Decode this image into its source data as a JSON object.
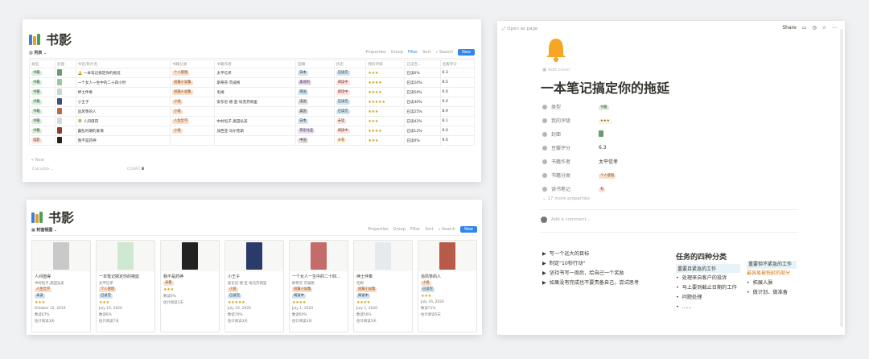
{
  "db_title": "书影",
  "table_view": {
    "view_label": "列表",
    "toolbar": [
      "Properties",
      "Group",
      "Filter",
      "Sort",
      "Search"
    ],
    "new_label": "New",
    "headers": [
      "类型",
      "封面",
      "书名/影片名",
      "书籍分类",
      "书籍作者",
      "国籍",
      "状态",
      "我的评级",
      "已读百...",
      "豆瓣评分"
    ],
    "rows": [
      {
        "type": "书籍",
        "cover": "#6a9b6e",
        "name": "一本笔记搞定你的拖延",
        "name_icon": "🔔",
        "cat": "个人管理",
        "cat_c": "t-orange",
        "author": "太平信孝",
        "nation": "日本",
        "nat_c": "t-blue",
        "status": "已读完",
        "st_c": "t-blue",
        "stars": "★★★",
        "pct": "已读6%",
        "score": "6.3"
      },
      {
        "type": "书籍",
        "cover": "#9bc4a4",
        "name": "一个女人一生中的二十四小时",
        "name_icon": "",
        "cat": "短篇小说集",
        "cat_c": "t-orange",
        "author": "斯蒂芬·茨威格",
        "nation": "奥地利",
        "nat_c": "t-purple",
        "status": "阅读中",
        "st_c": "t-red",
        "stars": "★★★★",
        "pct": "已读20%",
        "score": "8.5"
      },
      {
        "type": "书籍",
        "cover": "#c5d7cf",
        "name": "绅士伴奏",
        "name_icon": "",
        "cat": "短篇小说集",
        "cat_c": "t-orange",
        "author": "毛姆",
        "nation": "英国",
        "nat_c": "t-blue",
        "status": "阅读中",
        "st_c": "t-red",
        "stars": "★★★★",
        "pct": "已读50%",
        "score": "0.0"
      },
      {
        "type": "书籍",
        "cover": "#3a4f7a",
        "name": "小王子",
        "name_icon": "",
        "cat": "小说",
        "cat_c": "t-orange",
        "author": "安东尼·德·圣-埃克苏佩里",
        "nation": "法国",
        "nat_c": "t-gray",
        "status": "已读完",
        "st_c": "t-blue",
        "stars": "★★★★★",
        "pct": "已读30%",
        "score": "9.0"
      },
      {
        "type": "书籍",
        "cover": "#b56a4a",
        "name": "追风筝的人",
        "name_icon": "",
        "cat": "小说",
        "cat_c": "t-orange",
        "author": "",
        "nation": "美国",
        "nat_c": "t-gray",
        "status": "已读完",
        "st_c": "t-blue",
        "stars": "★★★",
        "pct": "已读25%",
        "score": "8.9"
      },
      {
        "type": "书籍",
        "cover": "#d8d8d8",
        "name": "人间值得",
        "name_icon": "🍀",
        "cat": "人生哲学",
        "cat_c": "t-orange",
        "author": "中村恒子,奥田弘美",
        "nation": "日本",
        "nat_c": "t-blue",
        "status": "未读",
        "st_c": "t-red",
        "stars": "★★★",
        "pct": "已读42%",
        "score": "8.1"
      },
      {
        "type": "书籍",
        "cover": "#8f3b2f",
        "name": "霸乱时期的爱情",
        "name_icon": "",
        "cat": "小说",
        "cat_c": "t-orange",
        "author": "加西亚·马尔克斯",
        "nation": "哥伦比亚",
        "nat_c": "t-purple",
        "status": "阅读中",
        "st_c": "t-red",
        "stars": "★★★★",
        "pct": "已读12%",
        "score": "9.0"
      },
      {
        "type": "电影",
        "cover": "#222",
        "name": "我不是药神",
        "name_icon": "",
        "cat": "",
        "cat_c": "",
        "author": "",
        "nation": "中国",
        "nat_c": "t-gray",
        "status": "未看",
        "st_c": "t-yellow",
        "stars": "★★★",
        "pct": "已读0%",
        "score": "9.0"
      }
    ],
    "new_row": "+ New",
    "calculate": "Calculate",
    "count_label": "COUNT",
    "count": "8"
  },
  "gallery_view": {
    "view_label": "封面视图",
    "cards": [
      {
        "img": "#c9c9c9",
        "name": "人间值得",
        "author": "中村恒子,奥田弘美",
        "tag": "人生哲学",
        "tag2": "未读",
        "stars": "★★★",
        "date": "October 12, 2019",
        "pct": "数读67%",
        "extra": "估计阅读3天"
      },
      {
        "img": "#cfe8d2",
        "name": "一本笔记搞定你的拖延",
        "author": "太平信孝",
        "tag": "个人管理",
        "tag2": "已读完",
        "stars": "★★★",
        "date": "July 16, 2020",
        "pct": "数读6%",
        "extra": "估计阅读7天"
      },
      {
        "img": "#222",
        "name": "我不是药神",
        "author": "",
        "tag": "未看",
        "tag2": "",
        "stars": "★★★",
        "date": "",
        "pct": "数读0%",
        "extra": "估计阅读1天"
      },
      {
        "img": "#2a3a6a",
        "name": "小王子",
        "author": "安东尼·德·圣-埃克苏佩里",
        "tag": "小说",
        "tag2": "已读完",
        "stars": "★★★★★",
        "date": "July 16, 2020",
        "pct": "数读70%",
        "extra": "估计阅读3天"
      },
      {
        "img": "#c46b6b",
        "name": "一个女人一生中的二十四...",
        "author": "斯蒂芬·茨威格",
        "tag": "短篇小说集",
        "tag2": "阅读中",
        "stars": "★★★★",
        "date": "July 1, 2020",
        "pct": "数读60%",
        "extra": "估计阅读3天"
      },
      {
        "img": "#e4eaee",
        "name": "绅士伴奏",
        "author": "毛姆",
        "tag": "短篇小说集",
        "tag2": "阅读中",
        "stars": "★★★★",
        "date": "July 1, 2020",
        "pct": "数读50%",
        "extra": "估计阅读5天"
      },
      {
        "img": "#b85a4a",
        "name": "追风筝的人",
        "author": "",
        "tag": "小说",
        "tag2": "已读完",
        "stars": "★★★",
        "date": "July 16, 2020",
        "pct": "数读71%",
        "extra": "估计阅读5天"
      }
    ]
  },
  "page_view": {
    "open_as_page": "Open as page",
    "share": "Share",
    "add_cover": "Add cover",
    "title": "一本笔记搞定你的拖延",
    "props": [
      {
        "k": "类型",
        "v": "书籍",
        "c": "t-green"
      },
      {
        "k": "我的评级",
        "v": "★★★",
        "c": "t-yellow"
      },
      {
        "k": "封面",
        "v": "",
        "c": ""
      },
      {
        "k": "豆瓣评分",
        "v": "6.3",
        "c": ""
      },
      {
        "k": "书籍作者",
        "v": "太平信孝",
        "c": ""
      },
      {
        "k": "书籍分类",
        "v": "个人管理",
        "c": "t-orange"
      },
      {
        "k": "读书笔记",
        "v": "有",
        "c": "t-red"
      }
    ],
    "more_props": "17 more properties",
    "add_comment": "Add a comment...",
    "bullets": [
      "写一个远大的目标",
      "制定\"10秒行动\"",
      "坚持书写一周后，给自己一个奖励",
      "如果没有完成也不要责备自己，尝试思考"
    ],
    "quad_title": "任务的四种分类",
    "quad1_title": "重要且紧急的工作",
    "quad1_items": [
      "处理来自客户的投诉",
      "马上要到截止日期的工作",
      "问题处理",
      "......"
    ],
    "quad2_title": "重要但不紧急的工作",
    "quad2_sub": "最容易被拖延的部分",
    "quad2_items": [
      "拓展人脉",
      "做计划、做准备"
    ]
  }
}
